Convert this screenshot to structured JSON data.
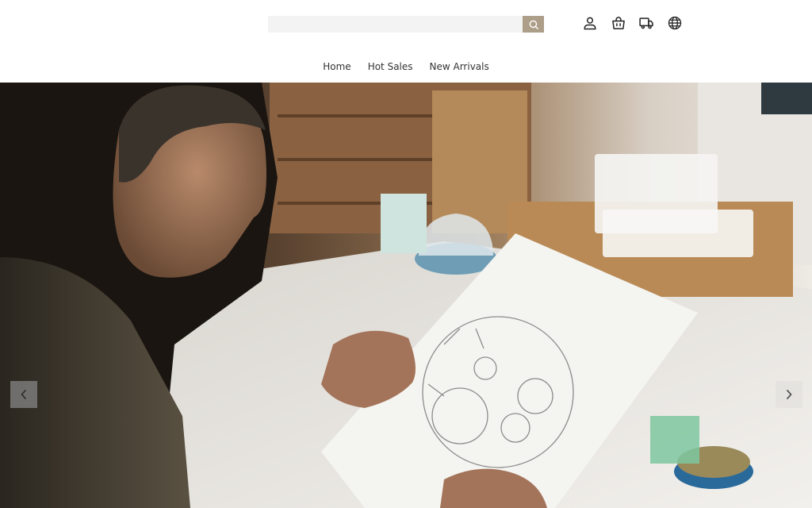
{
  "search": {
    "placeholder": "",
    "value": ""
  },
  "header_icons": [
    "user-icon",
    "shopping-bag-icon",
    "delivery-truck-icon",
    "globe-icon"
  ],
  "nav": {
    "items": [
      "Home",
      "Hot Sales",
      "New Arrivals"
    ]
  },
  "colors": {
    "search_button": "#ad9e89",
    "nav_text": "#333333",
    "icon_stroke": "#222222"
  }
}
